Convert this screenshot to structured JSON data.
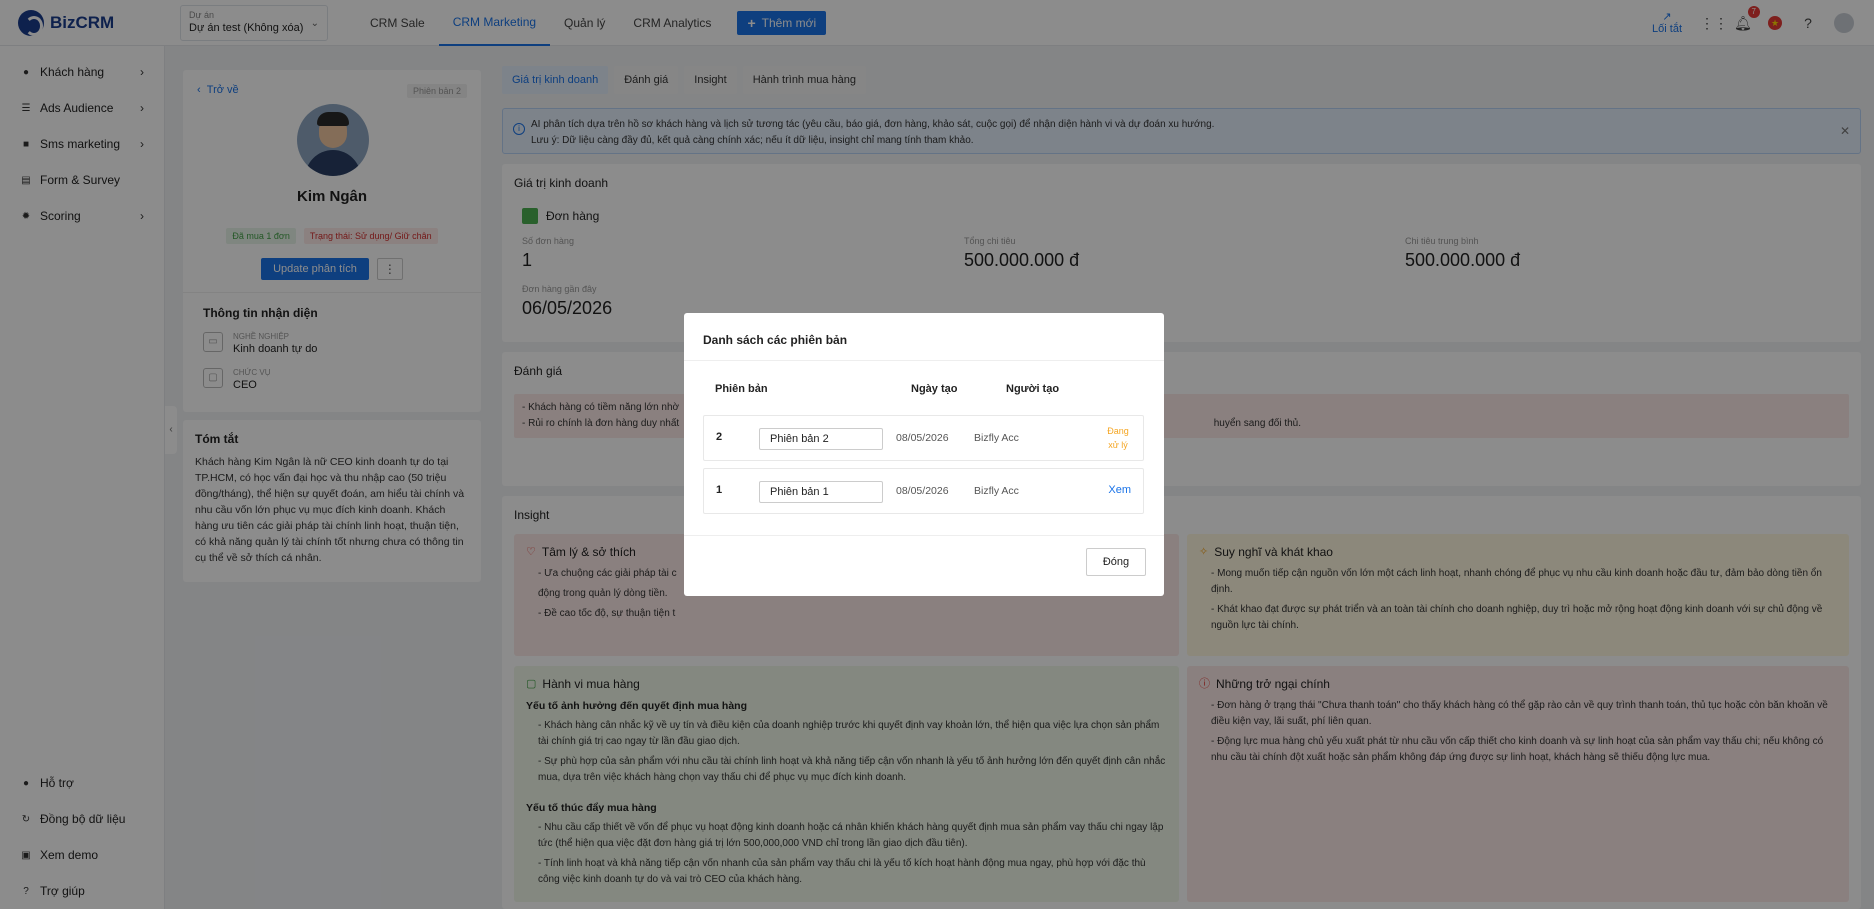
{
  "brand": {
    "name": "BizCRM",
    "accent": "#1a73e8"
  },
  "project": {
    "label": "Dự án",
    "value": "Dự án test (Không xóa)"
  },
  "nav": [
    "CRM Sale",
    "CRM Marketing",
    "Quản lý",
    "CRM Analytics"
  ],
  "add_button": "Thêm mới",
  "topright": {
    "shortcut": "Lối tắt",
    "notifications": "7"
  },
  "sidebar": {
    "top": [
      "Khách hàng",
      "Ads Audience",
      "Sms marketing",
      "Form & Survey",
      "Scoring"
    ],
    "bottom": [
      "Hỗ trợ",
      "Đồng bộ dữ liệu",
      "Xem demo",
      "Trợ giúp"
    ]
  },
  "profile": {
    "back": "Trở về",
    "version": "Phiên bản 2",
    "name": "Kim Ngân",
    "tag_bought": "Đã mua 1 đơn",
    "tag_status": "Trạng thái: Sử dụng/ Giữ chân",
    "update_btn": "Update phân tích",
    "more": "⋮",
    "id_title": "Thông tin nhận diện",
    "job_label": "Nghề nghiệp",
    "job_value": "Kinh doanh tự do",
    "role_label": "Chức vụ",
    "role_value": "CEO"
  },
  "summary": {
    "title": "Tóm tắt",
    "text": "Khách hàng Kim Ngân là nữ CEO kinh doanh tự do tại TP.HCM, có học vấn đại học và thu nhập cao (50 triệu đồng/tháng), thể hiện sự quyết đoán, am hiểu tài chính và nhu cầu vốn lớn phục vụ mục đích kinh doanh. Khách hàng ưu tiên các giải pháp tài chính linh hoạt, thuận tiện, có khả năng quản lý tài chính tốt nhưng chưa có thông tin cụ thể về sở thích cá nhân."
  },
  "tabs": [
    "Giá trị kinh doanh",
    "Đánh giá",
    "Insight",
    "Hành trình mua hàng"
  ],
  "alert": {
    "line1": "AI phân tích dựa trên hồ sơ khách hàng và lịch sử tương tác (yêu cầu, báo giá, đơn hàng, khảo sát, cuộc gọi) để nhận diện hành vi và dự đoán xu hướng.",
    "line2": "Lưu ý: Dữ liệu càng đầy đủ, kết quả càng chính xác; nếu ít dữ liệu, insight chỉ mang tính tham khảo."
  },
  "business": {
    "title": "Giá trị kinh doanh",
    "orders": "Đơn hàng",
    "count_label": "Số đơn hàng",
    "count_value": "1",
    "total_label": "Tổng chi tiêu",
    "total_value": "500.000.000 đ",
    "avg_label": "Chi tiêu trung bình",
    "avg_value": "500.000.000 đ",
    "recent_label": "Đơn hàng gần đây",
    "recent_value": "06/05/2026"
  },
  "evaluation": {
    "title": "Đánh giá",
    "line1": "- Khách hàng có tiềm năng lớn nhờ",
    "line2": "- Rủi ro chính là đơn hàng duy nhất",
    "line2_end": "huyển sang đối thủ."
  },
  "insight": {
    "title": "Insight",
    "psych": {
      "title": "Tâm lý & sở thích",
      "items": [
        "- Ưa chuộng các giải pháp tài c",
        "động trong quản lý dòng tiền.",
        "- Đề cao tốc độ, sự thuận tiện t"
      ]
    },
    "thought": {
      "title": "Suy nghĩ và khát khao",
      "items": [
        "- Mong muốn tiếp cận nguồn vốn lớn một cách linh hoạt, nhanh chóng để phục vụ nhu cầu kinh doanh hoặc đầu tư, đảm bảo dòng tiền ổn định.",
        "- Khát khao đạt được sự phát triển và an toàn tài chính cho doanh nghiệp, duy trì hoặc mở rộng hoạt động kinh doanh với sự chủ động về nguồn lực tài chính."
      ]
    },
    "behavior": {
      "title": "Hành vi mua hàng",
      "sub1": "Yếu tố ảnh hưởng đến quyết định mua hàng",
      "items1": [
        "- Khách hàng cân nhắc kỹ về uy tín và điều kiện của doanh nghiệp trước khi quyết định vay khoản lớn, thể hiện qua việc lựa chọn sản phẩm tài chính giá trị cao ngay từ lần đầu giao dịch.",
        "- Sự phù hợp của sản phẩm với nhu cầu tài chính linh hoạt và khả năng tiếp cận vốn nhanh là yếu tố ảnh hưởng lớn đến quyết định cân nhắc mua, dựa trên việc khách hàng chọn vay thấu chi để phục vụ mục đích kinh doanh."
      ],
      "sub2": "Yếu tố thúc đẩy mua hàng",
      "items2": [
        "- Nhu cầu cấp thiết về vốn để phục vụ hoạt động kinh doanh hoặc cá nhân khiến khách hàng quyết định mua sản phẩm vay thấu chi ngay lập tức (thể hiện qua việc đặt đơn hàng giá trị lớn 500,000,000 VND chỉ trong lần giao dịch đầu tiên).",
        "- Tính linh hoạt và khả năng tiếp cận vốn nhanh của sản phẩm vay thấu chi là yếu tố kích hoạt hành động mua ngay, phù hợp với đặc thù công việc kinh doanh tự do và vai trò CEO của khách hàng."
      ]
    },
    "obstacle": {
      "title": "Những trở ngại chính",
      "items": [
        "- Đơn hàng ở trạng thái \"Chưa thanh toán\" cho thấy khách hàng có thể gặp rào cản về quy trình thanh toán, thủ tục hoặc còn băn khoăn về điều kiện vay, lãi suất, phí liên quan.",
        "- Động lực mua hàng chủ yếu xuất phát từ nhu cầu vốn cấp thiết cho kinh doanh và sự linh hoạt của sản phẩm vay thấu chi; nếu không có nhu cầu tài chính đột xuất hoặc sản phẩm không đáp ứng được sự linh hoạt, khách hàng sẽ thiếu động lực mua."
      ]
    }
  },
  "modal": {
    "title": "Danh sách các phiên bản",
    "headers": {
      "version": "Phiên bản",
      "date": "Ngày tạo",
      "creator": "Người tạo"
    },
    "rows": [
      {
        "num": "2",
        "name": "Phiên bản 2",
        "date": "08/05/2026",
        "creator": "Bizfly Acc",
        "status": "Đang xử lý"
      },
      {
        "num": "1",
        "name": "Phiên bản 1",
        "date": "08/05/2026",
        "creator": "Bizfly Acc",
        "action": "Xem"
      }
    ],
    "close": "Đóng"
  }
}
